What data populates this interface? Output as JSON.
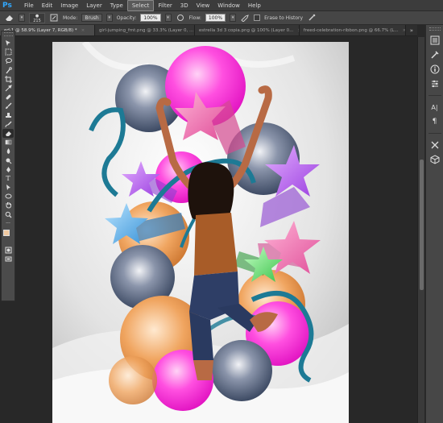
{
  "app": {
    "logo": "Ps"
  },
  "menu": [
    "File",
    "Edit",
    "Image",
    "Layer",
    "Type",
    "Select",
    "Filter",
    "3D",
    "View",
    "Window",
    "Help"
  ],
  "menu_active": "Select",
  "options": {
    "brush_size": "215",
    "mode_label": "Mode:",
    "mode_value": "Brush",
    "opacity_label": "Opacity:",
    "opacity_value": "100%",
    "flow_label": "Flow:",
    "flow_value": "100%",
    "erase_history_label": "Erase to History"
  },
  "tabs": [
    {
      "label": "ed-1 @ 58.9% (Layer 7, RGB/8) *",
      "active": true
    },
    {
      "label": "girl-jumping_fmt.png @ 33.3% (Layer 0, ...",
      "active": false
    },
    {
      "label": "estrella 3d 3 copia.png @ 100% (Layer 0...",
      "active": false
    },
    {
      "label": "freed-celebration-ribbon.png @ 66.7% (L...",
      "active": false
    }
  ],
  "tabs_more": "»",
  "tools": [
    "move-tool-icon",
    "marquee-tool-icon",
    "lasso-tool-icon",
    "quick-select-icon",
    "crop-tool-icon",
    "eyedropper-icon",
    "healing-brush-icon",
    "brush-tool-icon",
    "clone-stamp-icon",
    "history-brush-icon",
    "eraser-tool-icon",
    "gradient-tool-icon",
    "blur-tool-icon",
    "dodge-tool-icon",
    "pen-tool-icon",
    "type-tool-icon",
    "path-select-icon",
    "shape-tool-icon",
    "hand-tool-icon",
    "zoom-tool-icon"
  ],
  "colors": {
    "foreground": "#f0c9a0",
    "background": "#000000",
    "magenta": "#ff2bd6",
    "navy": "#2f3d55",
    "orange": "#e38a3a",
    "teal": "#1f7f9a"
  },
  "dock": [
    "history-icon",
    "properties-icon",
    "info-icon",
    "character-icon",
    "paragraph-icon",
    "tools-preset-icon",
    "3d-icon"
  ]
}
